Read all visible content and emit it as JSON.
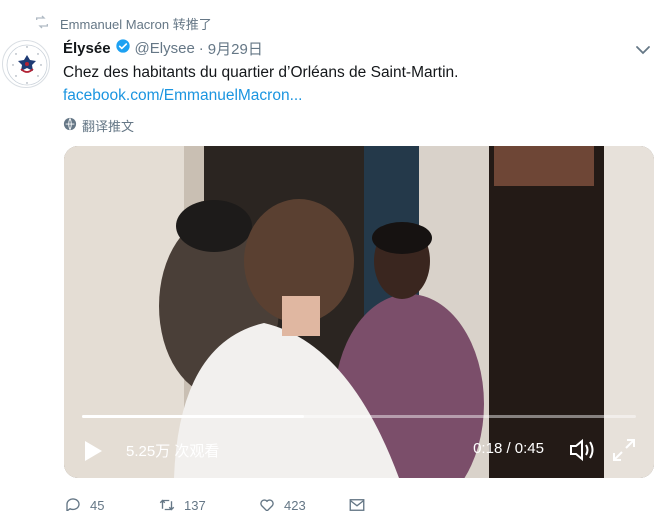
{
  "retweet": {
    "icon": "retweet-icon",
    "text": "Emmanuel Macron 转推了"
  },
  "tweet": {
    "author_name": "Élysée",
    "verified": true,
    "handle": "@Elysee",
    "separator": "·",
    "date": "9月29日",
    "text": "Chez des habitants du quartier d’Orléans de Saint-Martin.",
    "link": "facebook.com/EmmanuelMacron...",
    "translate_label": "翻译推文"
  },
  "video": {
    "views": "5.25万 次观看",
    "time": "0:18 / 0:45",
    "progress": 0.4
  },
  "actions": {
    "reply_count": "45",
    "retweet_count": "137",
    "like_count": "423"
  },
  "colors": {
    "link": "#1b95e0",
    "muted": "#657786",
    "text": "#14171a",
    "verified": "#1da1f2"
  }
}
